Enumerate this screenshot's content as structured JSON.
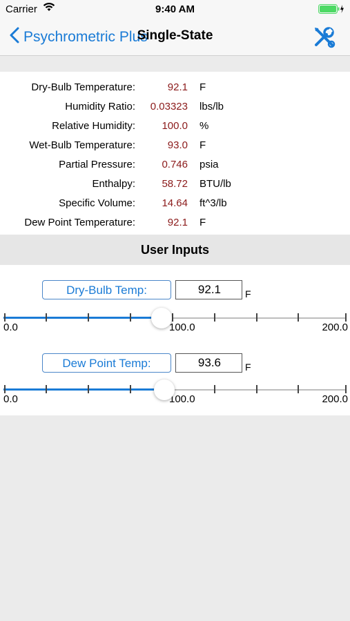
{
  "status_bar": {
    "carrier": "Carrier",
    "time": "9:40 AM"
  },
  "nav": {
    "back_label": "Psychrometric Plus",
    "title": "Single-State"
  },
  "properties": [
    {
      "label": "Dry-Bulb Temperature:",
      "value": "92.1",
      "unit": "F"
    },
    {
      "label": "Humidity Ratio:",
      "value": "0.03323",
      "unit": "lbs/lb"
    },
    {
      "label": "Relative Humidity:",
      "value": "100.0",
      "unit": "%"
    },
    {
      "label": "Wet-Bulb Temperature:",
      "value": "93.0",
      "unit": "F"
    },
    {
      "label": "Partial Pressure:",
      "value": "0.746",
      "unit": "psia"
    },
    {
      "label": "Enthalpy:",
      "value": "58.72",
      "unit": "BTU/lb"
    },
    {
      "label": "Specific Volume:",
      "value": "14.64",
      "unit": "ft^3/lb"
    },
    {
      "label": "Dew Point Temperature:",
      "value": "92.1",
      "unit": "F"
    }
  ],
  "user_inputs": {
    "header": "User Inputs",
    "dry_bulb": {
      "label": "Dry-Bulb Temp:",
      "value": "92.1",
      "unit": "F",
      "slider": {
        "min_label": "0.0",
        "mid_label": "100.0",
        "max_label": "200.0",
        "level": 0.46
      }
    },
    "dew_point": {
      "label": "Dew Point Temp:",
      "value": "93.6",
      "unit": "F",
      "slider": {
        "min_label": "0.0",
        "mid_label": "100.0",
        "max_label": "200.0",
        "level": 0.468
      }
    }
  },
  "colors": {
    "accent": "#1a7bd6",
    "value_text": "#8b1a1a",
    "battery": "#4cd964"
  },
  "icons": {
    "back": "chevron-left-icon",
    "tools": "wrench-screwdriver-icon",
    "wifi": "wifi-icon",
    "battery": "battery-icon"
  }
}
